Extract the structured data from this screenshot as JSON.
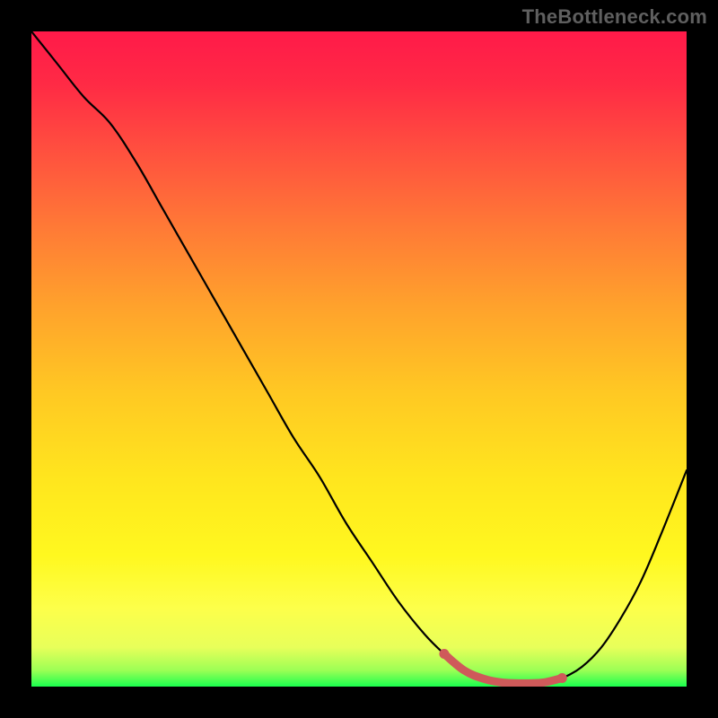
{
  "watermark": "TheBottleneck.com",
  "gradient_stops": [
    {
      "offset": 0.0,
      "color": "#ff1a49"
    },
    {
      "offset": 0.08,
      "color": "#ff2a45"
    },
    {
      "offset": 0.18,
      "color": "#ff4f3f"
    },
    {
      "offset": 0.3,
      "color": "#ff7a36"
    },
    {
      "offset": 0.42,
      "color": "#ffa22c"
    },
    {
      "offset": 0.55,
      "color": "#ffc823"
    },
    {
      "offset": 0.68,
      "color": "#ffe51e"
    },
    {
      "offset": 0.8,
      "color": "#fff81f"
    },
    {
      "offset": 0.88,
      "color": "#fdff4a"
    },
    {
      "offset": 0.94,
      "color": "#e8ff5a"
    },
    {
      "offset": 0.975,
      "color": "#9cff55"
    },
    {
      "offset": 1.0,
      "color": "#1aff4e"
    }
  ],
  "chart_data": {
    "type": "line",
    "title": "",
    "xlabel": "",
    "ylabel": "",
    "xlim": [
      0,
      100
    ],
    "ylim": [
      0,
      100
    ],
    "grid": false,
    "legend": false,
    "annotations": [],
    "series": [
      {
        "name": "bottleneck-curve",
        "color": "#000000",
        "x": [
          0,
          4,
          8,
          12,
          16,
          20,
          24,
          28,
          32,
          36,
          40,
          44,
          48,
          52,
          56,
          60,
          63,
          66,
          69,
          72,
          75,
          78,
          81,
          84,
          87,
          90,
          93,
          96,
          100
        ],
        "y": [
          100,
          95,
          90,
          86,
          80,
          73,
          66,
          59,
          52,
          45,
          38,
          32,
          25,
          19,
          13,
          8,
          5,
          2.5,
          1.2,
          0.6,
          0.5,
          0.6,
          1.3,
          3.0,
          6.0,
          10.5,
          16,
          23,
          33
        ]
      },
      {
        "name": "trough-highlight",
        "color": "#cf5a5a",
        "x": [
          63,
          66,
          69,
          72,
          75,
          78,
          81
        ],
        "y": [
          5,
          2.5,
          1.2,
          0.6,
          0.5,
          0.6,
          1.3
        ]
      }
    ]
  }
}
